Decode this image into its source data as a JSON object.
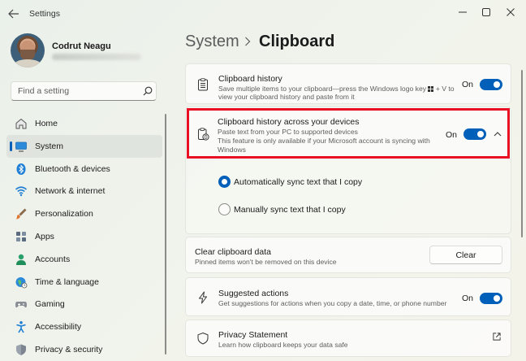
{
  "window": {
    "title": "Settings"
  },
  "profile": {
    "name": "Codrut Neagu"
  },
  "search": {
    "placeholder": "Find a setting"
  },
  "nav": {
    "items": [
      {
        "label": "Home",
        "icon": "home-icon"
      },
      {
        "label": "System",
        "icon": "monitor-icon",
        "selected": true
      },
      {
        "label": "Bluetooth & devices",
        "icon": "bluetooth-icon"
      },
      {
        "label": "Network & internet",
        "icon": "wifi-icon"
      },
      {
        "label": "Personalization",
        "icon": "brush-icon"
      },
      {
        "label": "Apps",
        "icon": "apps-icon"
      },
      {
        "label": "Accounts",
        "icon": "person-icon"
      },
      {
        "label": "Time & language",
        "icon": "globe-icon"
      },
      {
        "label": "Gaming",
        "icon": "gamepad-icon"
      },
      {
        "label": "Accessibility",
        "icon": "accessibility-icon"
      },
      {
        "label": "Privacy & security",
        "icon": "shield-icon"
      }
    ]
  },
  "header": {
    "parent": "System",
    "current": "Clipboard"
  },
  "cards": {
    "history": {
      "title": "Clipboard history",
      "desc1": "Save multiple items to your clipboard—press the Windows logo key",
      "desc1b": "+ V to",
      "desc2": "view your clipboard history and paste from it",
      "toggle_text": "On"
    },
    "across": {
      "title": "Clipboard history across your devices",
      "desc1": "Paste text from your PC to supported devices",
      "desc2": "This feature is only available if your Microsoft account is syncing with",
      "desc3": "Windows",
      "toggle_text": "On",
      "options": [
        {
          "label": "Automatically sync text that I copy",
          "selected": true
        },
        {
          "label": "Manually sync text that I copy",
          "selected": false
        }
      ]
    },
    "clear": {
      "title": "Clear clipboard data",
      "desc": "Pinned items won't be removed on this device",
      "button": "Clear"
    },
    "suggested": {
      "title": "Suggested actions",
      "desc": "Get suggestions for actions when you copy a date, time, or phone number",
      "toggle_text": "On"
    },
    "privacy": {
      "title": "Privacy Statement",
      "desc": "Learn how clipboard keeps your data safe"
    }
  },
  "colors": {
    "accent": "#005fb8",
    "highlight": "#e81123"
  }
}
